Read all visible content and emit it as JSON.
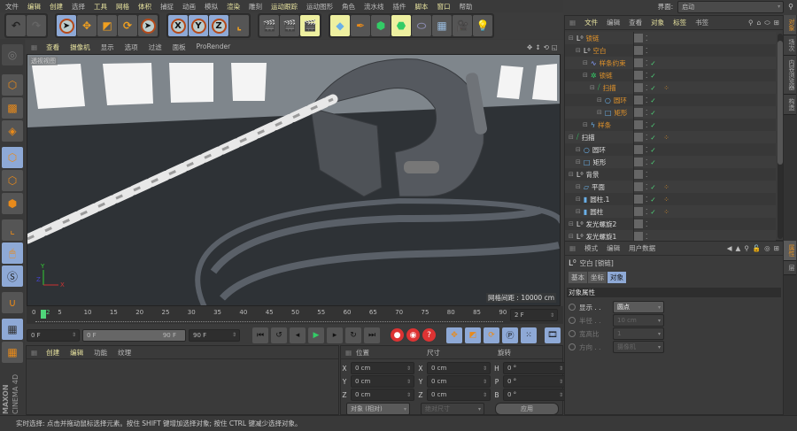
{
  "menu": [
    {
      "label": "文件",
      "hl": false
    },
    {
      "label": "编辑",
      "hl": true
    },
    {
      "label": "创建",
      "hl": true
    },
    {
      "label": "选择",
      "hl": false
    },
    {
      "label": "工具",
      "hl": true
    },
    {
      "label": "网格",
      "hl": true
    },
    {
      "label": "体积",
      "hl": true
    },
    {
      "label": "捕捉",
      "hl": false
    },
    {
      "label": "动画",
      "hl": false
    },
    {
      "label": "模拟",
      "hl": false
    },
    {
      "label": "渲染",
      "hl": true
    },
    {
      "label": "雕刻",
      "hl": false
    },
    {
      "label": "运动跟踪",
      "hl": true
    },
    {
      "label": "运动图形",
      "hl": false
    },
    {
      "label": "角色",
      "hl": false
    },
    {
      "label": "流水线",
      "hl": false
    },
    {
      "label": "插件",
      "hl": false
    },
    {
      "label": "脚本",
      "hl": true
    },
    {
      "label": "窗口",
      "hl": true
    },
    {
      "label": "帮助",
      "hl": false
    }
  ],
  "toolbar": {
    "axis_x": "X",
    "axis_y": "Y",
    "axis_z": "Z"
  },
  "interface": {
    "label": "界面:",
    "value": "启动"
  },
  "viewport": {
    "menu": [
      {
        "label": "查看",
        "hl": true
      },
      {
        "label": "摄像机",
        "hl": true
      },
      {
        "label": "显示",
        "hl": false
      },
      {
        "label": "选项",
        "hl": false
      },
      {
        "label": "过滤",
        "hl": false
      },
      {
        "label": "面板",
        "hl": false
      },
      {
        "label": "ProRender",
        "hl": false
      }
    ],
    "view_name": "透视视图",
    "grid_spacing": "网格间距 : 10000 cm",
    "axis_labels": {
      "x": "X",
      "y": "Y",
      "z": "Z"
    }
  },
  "timeline": {
    "ticks": [
      "0",
      "5",
      "10",
      "15",
      "20",
      "25",
      "30",
      "35",
      "40",
      "45",
      "50",
      "55",
      "60",
      "65",
      "70",
      "75",
      "80",
      "85",
      "90"
    ],
    "current_frame": "2",
    "current_frame_field": "2 F",
    "start": "0 F",
    "range_start": "0 F",
    "range_end": "90 F",
    "end": "90 F"
  },
  "material_manager": {
    "menu": [
      {
        "label": "创建",
        "hl": true
      },
      {
        "label": "编辑",
        "hl": true
      },
      {
        "label": "功能",
        "hl": false
      },
      {
        "label": "纹理",
        "hl": false
      }
    ]
  },
  "coordinates": {
    "headers": [
      "位置",
      "尺寸",
      "旋转"
    ],
    "rows": [
      {
        "a": "X",
        "pos": "0 cm",
        "b": "X",
        "size": "0 cm",
        "c": "H",
        "rot": "0 °"
      },
      {
        "a": "Y",
        "pos": "0 cm",
        "b": "Y",
        "size": "0 cm",
        "c": "P",
        "rot": "0 °"
      },
      {
        "a": "Z",
        "pos": "0 cm",
        "b": "Z",
        "size": "0 cm",
        "c": "B",
        "rot": "0 °"
      }
    ],
    "mode": "对象 (相对)",
    "size_mode": "绝对尺寸",
    "apply": "应用"
  },
  "status": "实时选择: 点击并拖动鼠标选择元素。按住 SHIFT 键增加选择对象; 按住 CTRL 键减少选择对象。",
  "object_manager": {
    "menu": [
      {
        "label": "文件",
        "hl": true
      },
      {
        "label": "编辑",
        "hl": false
      },
      {
        "label": "查看",
        "hl": false
      },
      {
        "label": "对象",
        "hl": true
      },
      {
        "label": "标签",
        "hl": true
      },
      {
        "label": "书签",
        "hl": false
      }
    ],
    "objects": [
      {
        "name": "锁链",
        "level": 0,
        "icon": "null",
        "selected": true,
        "check": false,
        "tag": false
      },
      {
        "name": "空白",
        "level": 1,
        "icon": "null",
        "selected": true,
        "check": false,
        "tag": false
      },
      {
        "name": "样条约束",
        "level": 2,
        "icon": "spline-wrap",
        "selected": true,
        "check": true,
        "tag": false
      },
      {
        "name": "锁链",
        "level": 2,
        "icon": "cloner",
        "selected": true,
        "check": true,
        "tag": false
      },
      {
        "name": "扫描",
        "level": 3,
        "icon": "sweep",
        "selected": true,
        "check": true,
        "tag": true
      },
      {
        "name": "圆环",
        "level": 4,
        "icon": "circle",
        "selected": true,
        "check": true,
        "tag": false
      },
      {
        "name": "矩形",
        "level": 4,
        "icon": "rectangle",
        "selected": true,
        "check": true,
        "tag": false
      },
      {
        "name": "样条",
        "level": 2,
        "icon": "spline",
        "selected": true,
        "check": true,
        "tag": false
      },
      {
        "name": "扫描",
        "level": 0,
        "icon": "sweep",
        "selected": false,
        "check": true,
        "tag": true
      },
      {
        "name": "圆环",
        "level": 1,
        "icon": "circle",
        "selected": false,
        "check": true,
        "tag": false
      },
      {
        "name": "矩形",
        "level": 1,
        "icon": "rectangle",
        "selected": false,
        "check": true,
        "tag": false
      },
      {
        "name": "背景",
        "level": 0,
        "icon": "null",
        "selected": false,
        "check": false,
        "tag": false
      },
      {
        "name": "平面",
        "level": 1,
        "icon": "plane",
        "selected": false,
        "check": true,
        "tag": true
      },
      {
        "name": "圆柱.1",
        "level": 1,
        "icon": "cylinder",
        "selected": false,
        "check": true,
        "tag": true
      },
      {
        "name": "圆柱",
        "level": 1,
        "icon": "cylinder",
        "selected": false,
        "check": true,
        "tag": true
      },
      {
        "name": "发光螺旋2",
        "level": 0,
        "icon": "null",
        "selected": false,
        "check": false,
        "tag": false
      },
      {
        "name": "发光螺旋1",
        "level": 0,
        "icon": "null",
        "selected": false,
        "check": false,
        "tag": false
      }
    ]
  },
  "side_tabs": [
    "对象",
    "场次",
    "内容浏览器",
    "构造"
  ],
  "attr_side_tabs": [
    "属性",
    "层"
  ],
  "attributes": {
    "menu": [
      "模式",
      "编辑",
      "用户数据"
    ],
    "title": "空白 [锁链]",
    "tabs": [
      "基本",
      "坐标",
      "对象"
    ],
    "active_tab": 2,
    "section": "对象属性",
    "fields": [
      {
        "label": "显示 . .",
        "value": "圆点",
        "enabled": true
      },
      {
        "label": "半径 . .",
        "value": "10 cm",
        "enabled": false
      },
      {
        "label": "宽高比",
        "value": "1",
        "enabled": false
      },
      {
        "label": "方向 . .",
        "value": "摄像机",
        "enabled": false
      }
    ]
  },
  "brand": {
    "maxon": "MAXON",
    "product": "CINEMA 4D"
  },
  "colors": {
    "selected_text": "#e0922a",
    "accent_blue": "#8ea9d6",
    "check": "#4fd67a",
    "highlight_menu": "#e9e4a0"
  }
}
